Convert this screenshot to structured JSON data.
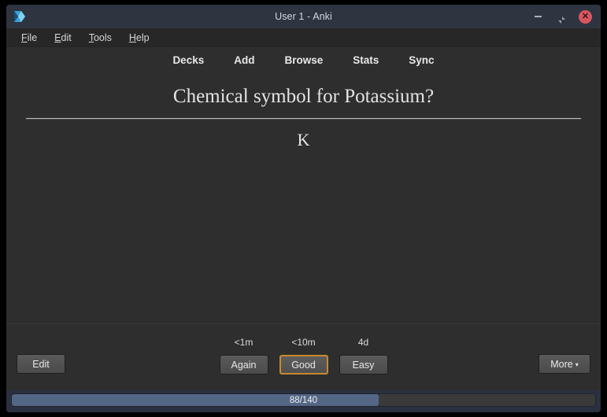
{
  "window": {
    "title": "User 1 - Anki",
    "app_icon": "anki-logo-icon",
    "controls": {
      "minimize": "minimize-icon",
      "restore": "restore-icon",
      "close": "✕"
    }
  },
  "menubar": {
    "items": [
      {
        "accel": "F",
        "rest": "ile"
      },
      {
        "accel": "E",
        "rest": "dit"
      },
      {
        "accel": "T",
        "rest": "ools"
      },
      {
        "accel": "H",
        "rest": "elp"
      }
    ]
  },
  "navbar": {
    "items": [
      {
        "label": "Decks"
      },
      {
        "label": "Add"
      },
      {
        "label": "Browse"
      },
      {
        "label": "Stats"
      },
      {
        "label": "Sync"
      }
    ]
  },
  "card": {
    "question": "Chemical symbol for Potassium?",
    "answer": "K"
  },
  "review_bar": {
    "edit_label": "Edit",
    "more_label": "More",
    "more_caret": "▾",
    "ease_buttons": [
      {
        "interval": "<1m",
        "label": "Again",
        "focused": false
      },
      {
        "interval": "<10m",
        "label": "Good",
        "focused": true
      },
      {
        "interval": "4d",
        "label": "Easy",
        "focused": false
      }
    ]
  },
  "progress": {
    "label": "88/140",
    "current": 88,
    "total": 140,
    "percent": 62.9,
    "fill_color": "#546685"
  },
  "colors": {
    "window_chrome": "#2b3040",
    "titlebar": "#2e3440",
    "content_bg": "#2e2e2e",
    "menubar_bg": "#272727",
    "focus_accent": "#c8892a",
    "close_button": "#d8555f"
  }
}
